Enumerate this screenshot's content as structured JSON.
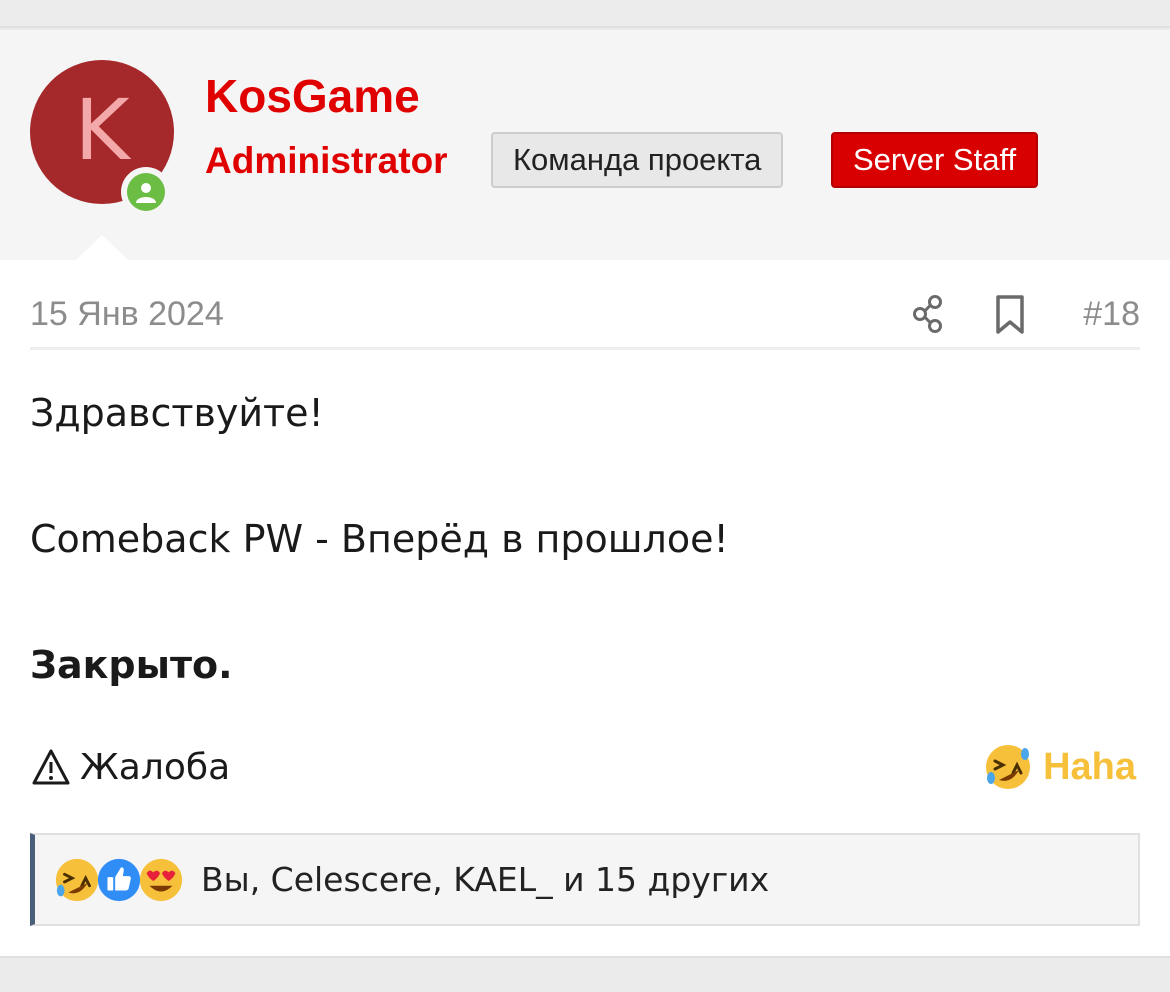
{
  "author": {
    "avatar_letter": "K",
    "avatar_color": "#a5282b",
    "username": "KosGame",
    "user_title": "Administrator",
    "banners": [
      "Команда проекта",
      "Server Staff"
    ],
    "online_status_icon": "online-user-icon"
  },
  "post": {
    "date": "15 Янв 2024",
    "number": "#18",
    "share_icon": "share-icon",
    "bookmark_icon": "bookmark-icon",
    "lines": [
      "Здравствуйте!",
      "Comeback PW - Вперёд в прошлое!",
      "Закрыто."
    ]
  },
  "actions": {
    "report_label": "Жалоба",
    "report_icon": "warning-triangle-icon",
    "reaction_label": "Haha",
    "reaction_icon": "rolling-laughing-icon"
  },
  "reactions_summary": {
    "icons": [
      "rolling-laughing-icon",
      "like-icon",
      "heart-eyes-icon"
    ],
    "text": "Вы, Celescere, KAEL_ и 15 других"
  },
  "colors": {
    "username": "#e00000",
    "staff_banner": "#d80000",
    "reaction": "#f7c03a",
    "online": "#6bbd44"
  }
}
